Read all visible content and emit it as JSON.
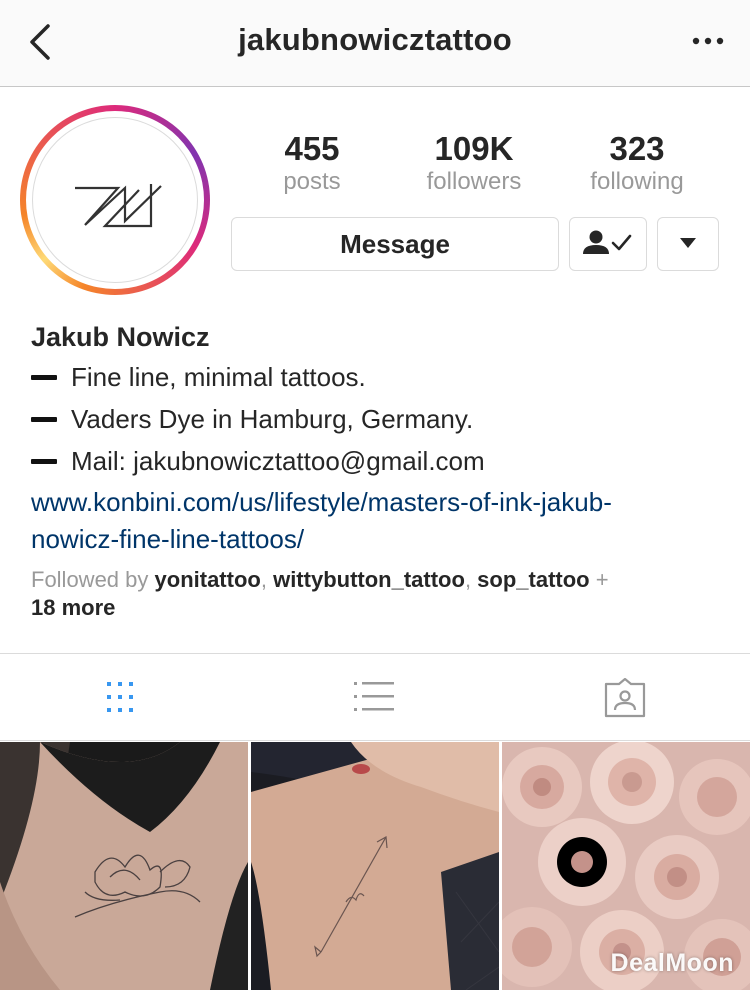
{
  "nav": {
    "title": "jakubnowicztattoo",
    "back_icon": "chevron-left-icon",
    "more_icon": "more-dots-icon"
  },
  "stats": [
    {
      "value": "455",
      "label": "posts"
    },
    {
      "value": "109K",
      "label": "followers"
    },
    {
      "value": "323",
      "label": "following"
    }
  ],
  "actions": {
    "message_label": "Message",
    "follow_icon": "following-check-icon",
    "dropdown_icon": "triangle-down-icon"
  },
  "bio": {
    "name": "Jakub Nowicz",
    "lines": [
      "Fine line, minimal tattoos.",
      "Vaders Dye in Hamburg, Germany.",
      "Mail: jakubnowicztattoo@gmail.com"
    ],
    "link_line1": "www.konbini.com/us/lifestyle/masters-of-ink-jakub-",
    "link_line2": "nowicz-fine-line-tattoos/",
    "followed_prefix": "Followed by ",
    "followed_users": [
      "yonitattoo",
      "wittybutton_tattoo",
      "sop_tattoo"
    ],
    "followed_sep": ", ",
    "followed_plus": " + ",
    "followed_more": "18 more"
  },
  "tabs": [
    {
      "icon": "grid-icon",
      "active": true
    },
    {
      "icon": "list-icon",
      "active": false
    },
    {
      "icon": "tagged-icon",
      "active": false
    }
  ],
  "watermark": "DealMoon",
  "colors": {
    "accent": "#3897f0",
    "link": "#003569",
    "muted": "#999999",
    "border": "#dbdbdb"
  }
}
